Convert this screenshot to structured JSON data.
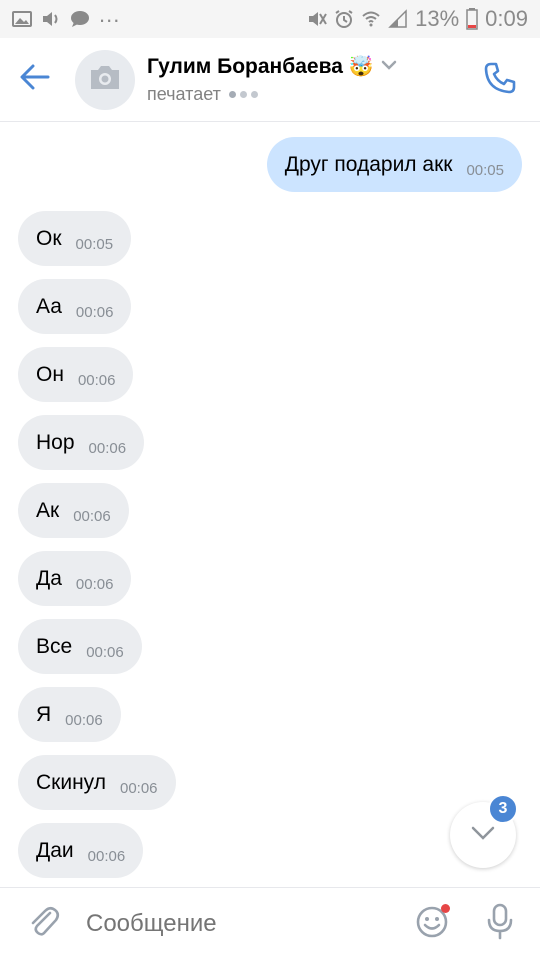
{
  "status_bar": {
    "dots": "...",
    "battery_percent": "13%",
    "time": "0:09"
  },
  "header": {
    "contact_name": "Гулим Боранбаева",
    "name_emoji": "🤯",
    "status": "печатает"
  },
  "messages": [
    {
      "direction": "out",
      "text": "Друг подарил акк",
      "time": "00:05"
    },
    {
      "direction": "in",
      "text": "Ок",
      "time": "00:05"
    },
    {
      "direction": "in",
      "text": "Аа",
      "time": "00:06"
    },
    {
      "direction": "in",
      "text": "Он",
      "time": "00:06"
    },
    {
      "direction": "in",
      "text": "Нор",
      "time": "00:06"
    },
    {
      "direction": "in",
      "text": "Ак",
      "time": "00:06"
    },
    {
      "direction": "in",
      "text": "Да",
      "time": "00:06"
    },
    {
      "direction": "in",
      "text": "Все",
      "time": "00:06"
    },
    {
      "direction": "in",
      "text": "Я",
      "time": "00:06"
    },
    {
      "direction": "in",
      "text": "Скинул",
      "time": "00:06"
    },
    {
      "direction": "in",
      "text": "Даи",
      "time": "00:06"
    }
  ],
  "scroll_down": {
    "unread_count": "3"
  },
  "composer": {
    "placeholder": "Сообщение"
  },
  "colors": {
    "accent": "#4a86d4",
    "outgoing_bubble": "#cce4ff",
    "incoming_bubble": "#ebedf0",
    "badge": "#4a86d4",
    "notification_dot": "#e64646"
  },
  "icons": {
    "back": "arrow-left-icon",
    "avatar": "camera-icon",
    "name_menu": "chevron-down-icon",
    "call": "phone-icon",
    "scroll_down": "chevron-down-icon",
    "attach": "paperclip-icon",
    "emoji": "smiley-icon",
    "mic": "microphone-icon"
  }
}
